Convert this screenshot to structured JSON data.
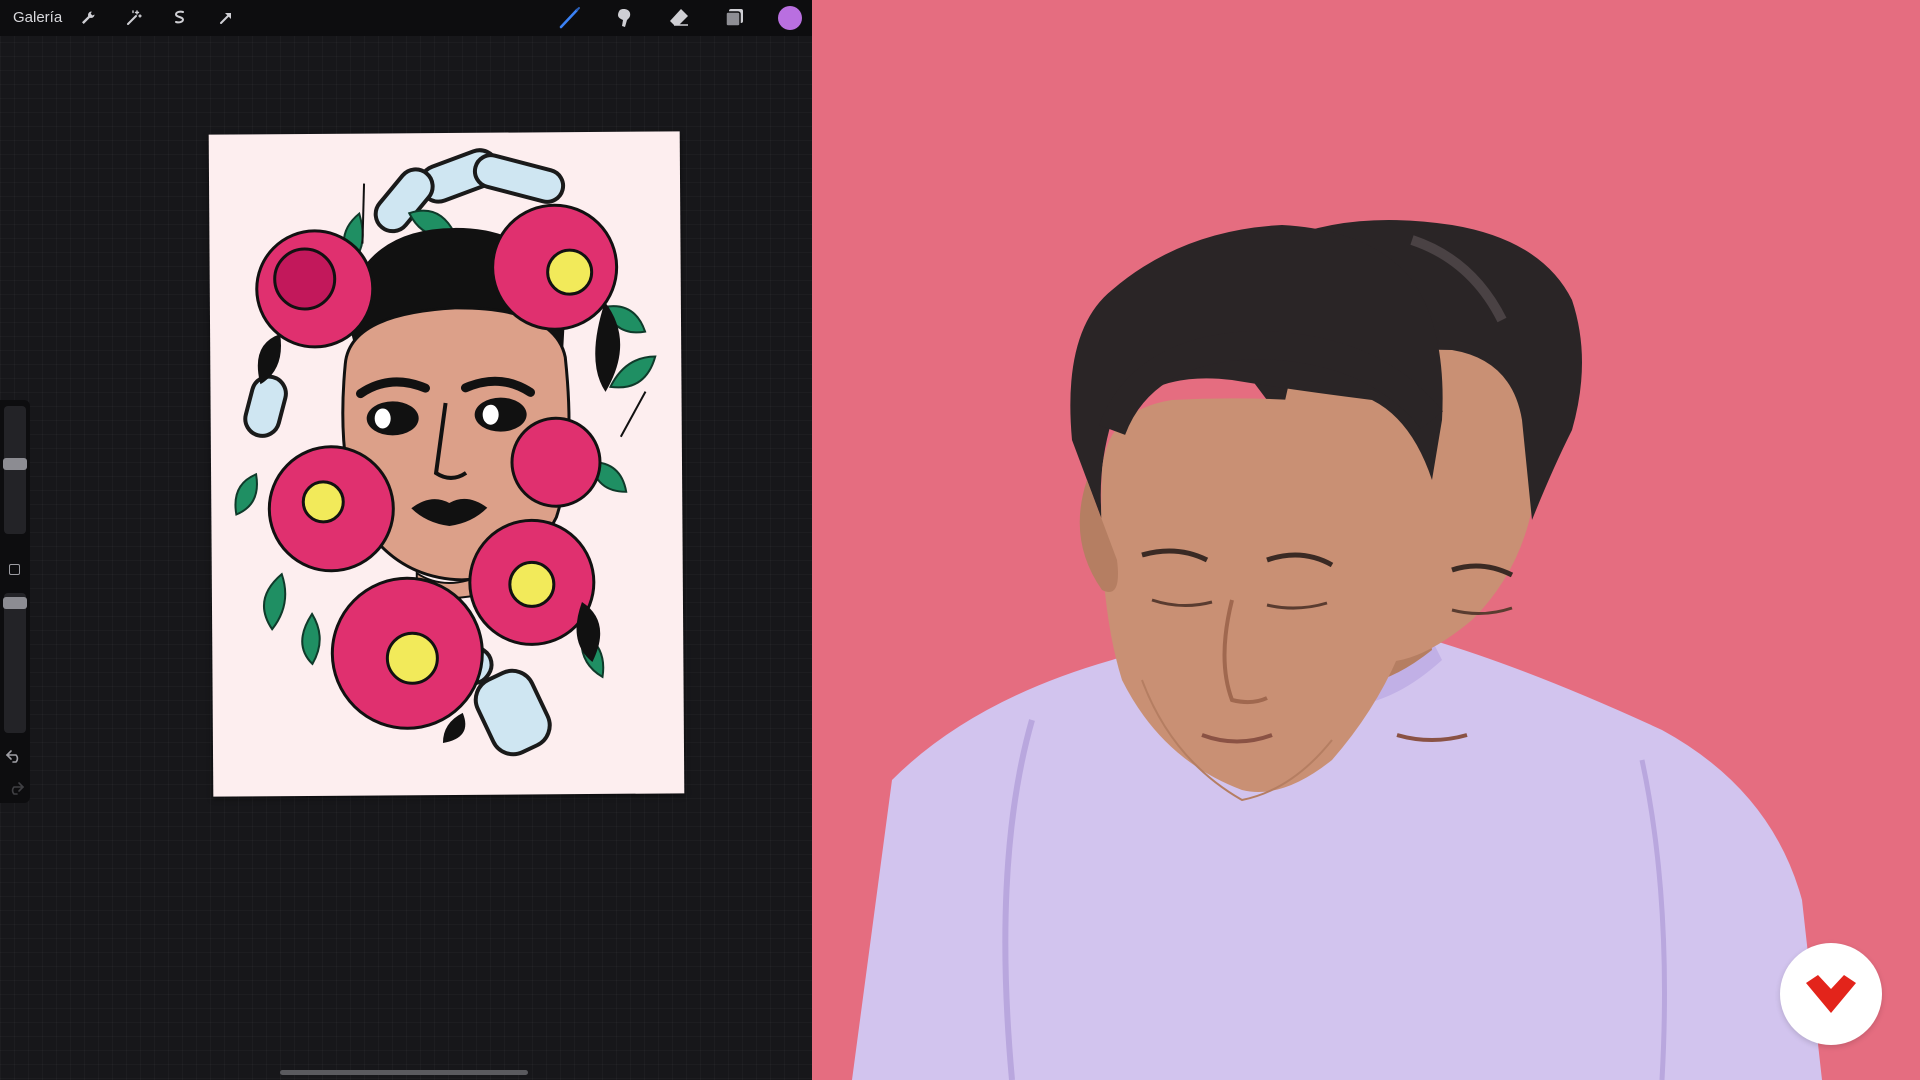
{
  "toolbar": {
    "gallery_label": "Galería",
    "left_icons": [
      "wrench-icon",
      "magic-wand-icon",
      "selection-icon",
      "transform-arrow-icon"
    ],
    "right_icons": [
      "brush-icon",
      "smudge-icon",
      "eraser-icon",
      "layers-icon"
    ],
    "current_color": "#b96fe0"
  },
  "sidebar": {
    "brush_size_level": 0.55,
    "opacity_level": 0.03
  },
  "video": {
    "background_color": "#e56d80"
  }
}
